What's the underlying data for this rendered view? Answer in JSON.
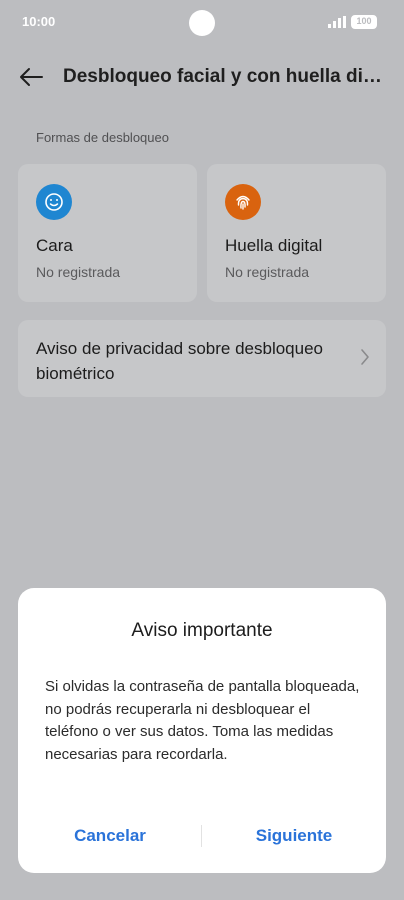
{
  "status_bar": {
    "time": "10:00",
    "battery": "100"
  },
  "header": {
    "title": "Desbloqueo facial y con huella digital"
  },
  "section": {
    "label": "Formas de desbloqueo"
  },
  "cards": [
    {
      "title": "Cara",
      "subtitle": "No registrada",
      "icon": "face-icon",
      "color": "#1f86d1"
    },
    {
      "title": "Huella digital",
      "subtitle": "No registrada",
      "icon": "fingerprint-icon",
      "color": "#d9630f"
    }
  ],
  "privacy": {
    "label": "Aviso de privacidad sobre desbloqueo biométrico"
  },
  "dialog": {
    "title": "Aviso importante",
    "body": "Si olvidas la contraseña de pantalla bloqueada, no podrás recuperarla ni desbloquear el teléfono o ver sus datos. Toma las medidas necesarias para recordarla.",
    "cancel_label": "Cancelar",
    "next_label": "Siguiente",
    "accent_color": "#2a73d9"
  }
}
